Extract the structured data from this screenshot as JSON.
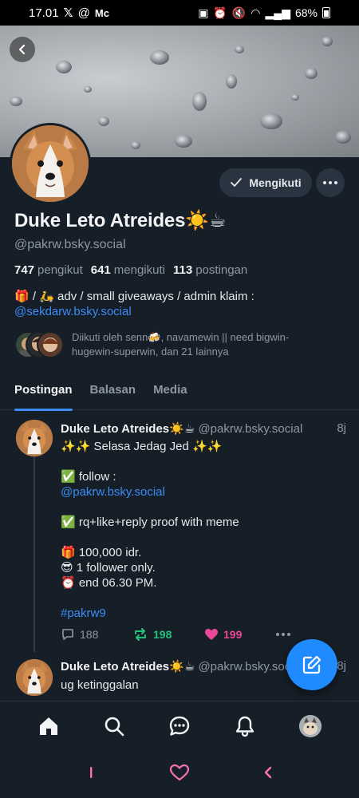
{
  "status_bar": {
    "time": "17.01",
    "notif_icons": [
      "x-logo-icon",
      "threads-icon",
      "mc-label"
    ],
    "mc_label": "Mc",
    "battery": "68%"
  },
  "profile": {
    "display_name": "Duke Leto Atreides☀️☕",
    "handle": "@pakrw.bsky.social",
    "follow_button": "Mengikuti",
    "stats": {
      "followers_count": "747",
      "followers_label": "pengikut",
      "following_count": "641",
      "following_label": "mengikuti",
      "posts_count": "113",
      "posts_label": "postingan"
    },
    "bio_text": "🎁 / 🛵 adv / small giveaways / admin klaim :",
    "bio_link": "@sekdarw.bsky.social",
    "followed_by": "Diikuti oleh senn🍻, navamewin || need bigwin-hugewin-superwin, dan 21 lainnya"
  },
  "tabs": [
    {
      "label": "Postingan",
      "active": true
    },
    {
      "label": "Balasan",
      "active": false
    },
    {
      "label": "Media",
      "active": false
    }
  ],
  "posts": [
    {
      "author": "Duke Leto Atreides☀️☕",
      "handle": "@pakrw.bsky.social",
      "time": "8j",
      "line1": "✨✨ Selasa Jedag Jed ✨✨",
      "line2": "✅ follow :",
      "link": "@pakrw.bsky.social",
      "line3": "✅ rq+like+reply proof with meme",
      "line4": "🎁 100,000 idr.",
      "line5": "😎 1 follower only.",
      "line6": "⏰  end 06.30 PM.",
      "hashtag": "#pakrw9",
      "replies": "188",
      "reposts": "198",
      "likes": "199"
    },
    {
      "author": "Duke Leto Atreides☀️☕",
      "handle": "@pakrw.bsky.social",
      "time": "8j",
      "text": "ug ketinggalan"
    }
  ],
  "colors": {
    "background": "#161e27",
    "accent": "#208bfe",
    "link": "#3b8cf5",
    "repost_active": "#22c37b",
    "like_active": "#ec4899",
    "muted": "#8e98a4"
  }
}
